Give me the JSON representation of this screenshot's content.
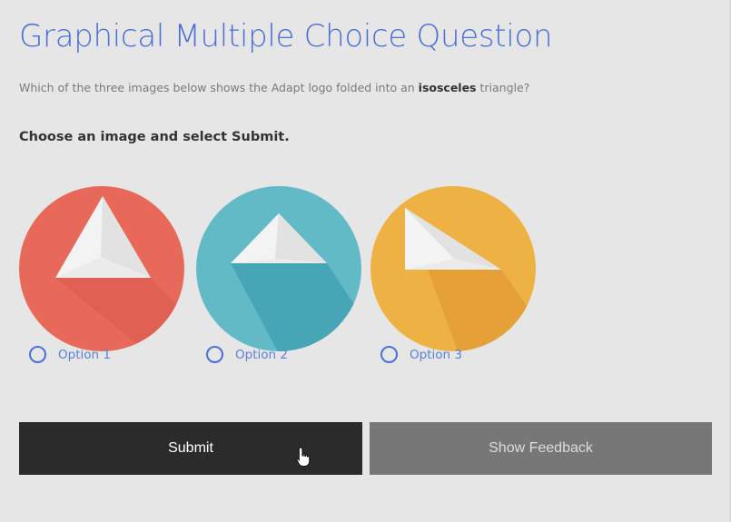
{
  "question": {
    "title": "Graphical Multiple Choice Question",
    "body_prefix": "Which of the three images below shows the Adapt logo folded into an ",
    "body_bold": "isosceles",
    "body_suffix": " triangle?",
    "instruction": "Choose an image and select Submit."
  },
  "options": [
    {
      "label": "Option 1",
      "color": "#e8685a",
      "selected": false
    },
    {
      "label": "Option 2",
      "color": "#62bac6",
      "selected": false
    },
    {
      "label": "Option 3",
      "color": "#eeb144",
      "selected": false
    }
  ],
  "buttons": {
    "submit": "Submit",
    "feedback": "Show Feedback"
  },
  "colors": {
    "accent": "#4a6fd8",
    "background": "#e6e6e6",
    "submit_bg": "#2b2b2b",
    "feedback_bg": "#777777"
  }
}
